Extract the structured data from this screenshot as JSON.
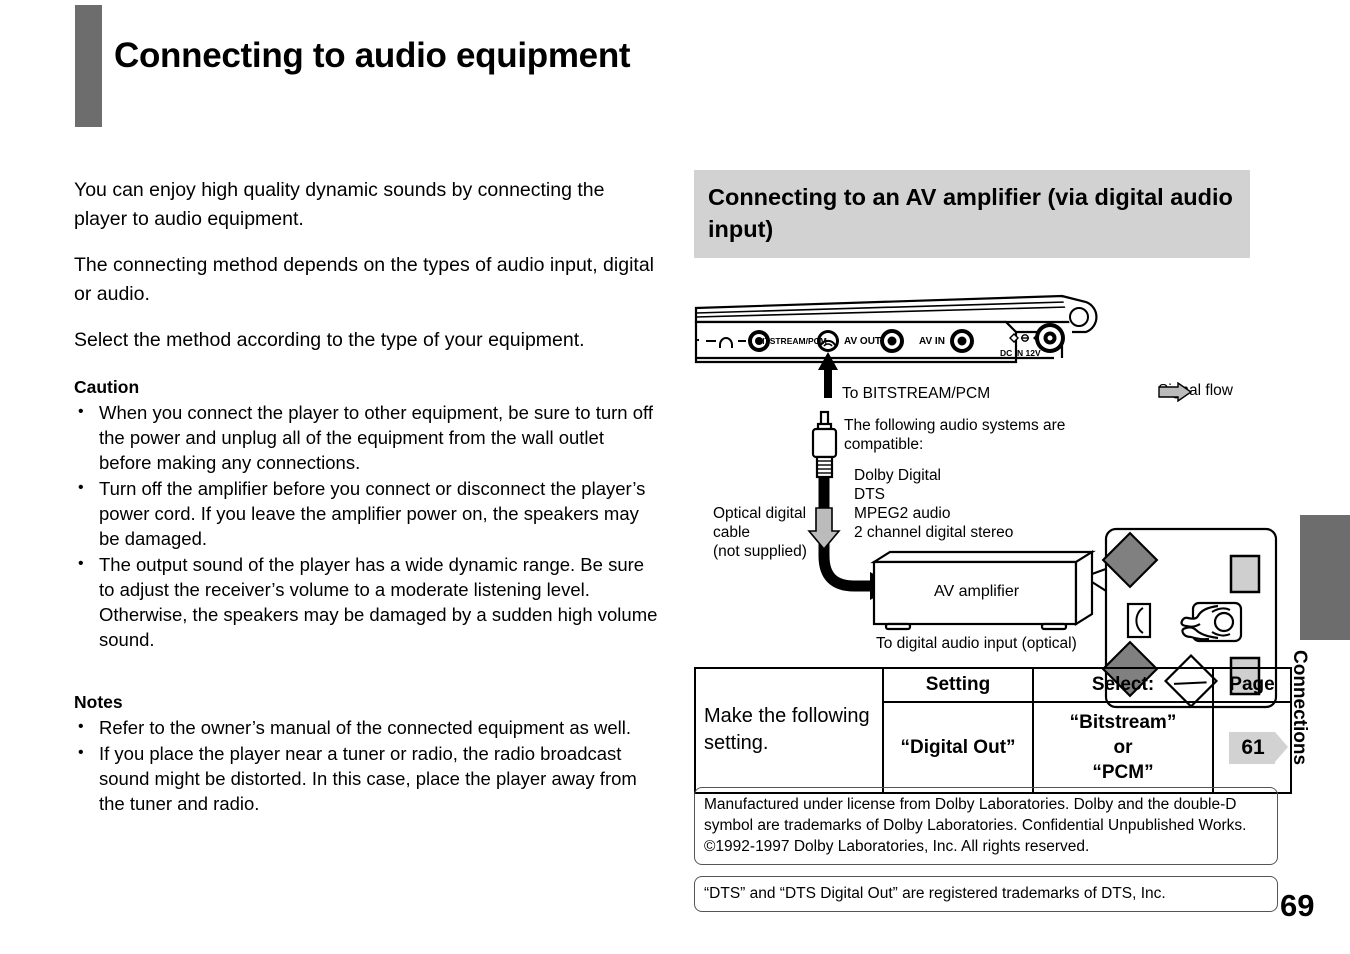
{
  "page": {
    "title": "Connecting to audio equipment",
    "folio": "69",
    "side_tab_label": "Connections",
    "accent_gray": "#6d6d6d",
    "panel_gray": "#d2d2d2"
  },
  "intro": {
    "paragraphs": [
      "You can enjoy high quality dynamic sounds by connecting the player to audio equipment.",
      "The connecting method depends on the types of audio input, digital or audio.",
      "Select the method according to the type of your equipment."
    ]
  },
  "caution": {
    "heading": "Caution",
    "items": [
      "When you connect the player to other equipment, be sure to turn off the power and unplug all of the equipment from the wall outlet before making any connections.",
      "Turn off the amplifier before you connect or disconnect the player’s power cord. If you leave the amplifier power on, the speakers may be damaged.",
      "The output sound of the player has a wide dynamic range. Be sure to adjust the receiver’s volume to a moderate listening level. Otherwise, the speakers may be damaged by a sudden high volume sound."
    ]
  },
  "notes": {
    "heading": "Notes",
    "items": [
      "Refer to the owner’s manual of the connected equipment as well.",
      "If you place the player near a tuner or radio, the radio broadcast sound might be distorted. In this case, place the player away from the tuner and radio."
    ]
  },
  "section": {
    "heading": "Connecting to an AV amplifier (via digital audio input)"
  },
  "diagram": {
    "signal_flow_label": "Signal flow",
    "rear_panel": {
      "ports": [
        {
          "label": "BITSTREAM/PCM"
        },
        {
          "label": "AV OUT"
        },
        {
          "label": "AV IN"
        },
        {
          "label": "DC IN 12V"
        }
      ]
    },
    "callout_bitstream": "To BITSTREAM/PCM",
    "cable_label": "Optical digital\ncable\n(not supplied)",
    "compatible_intro": "The following audio systems are\ncompatible:",
    "compatible_list": "Dolby Digital\nDTS\nMPEG2 audio\n2 channel digital stereo",
    "amplifier_label": "AV amplifier",
    "amplifier_input_label": "To digital audio input (optical)"
  },
  "settings_table": {
    "lead_cell": "Make the following setting.",
    "headers": [
      "Setting",
      "Select:",
      "Page"
    ],
    "rows": [
      {
        "setting": "“Digital Out”",
        "select": "“Bitstream”\nor\n“PCM”",
        "page": "61"
      }
    ]
  },
  "trademarks": {
    "dolby": "Manufactured under license from Dolby Laboratories. Dolby and the double-D symbol are trademarks of Dolby Laboratories. Confidential Unpublished Works. ©1992-1997 Dolby Laboratories, Inc. All rights reserved.",
    "dts": "“DTS” and “DTS Digital Out” are registered trademarks of DTS, Inc."
  }
}
